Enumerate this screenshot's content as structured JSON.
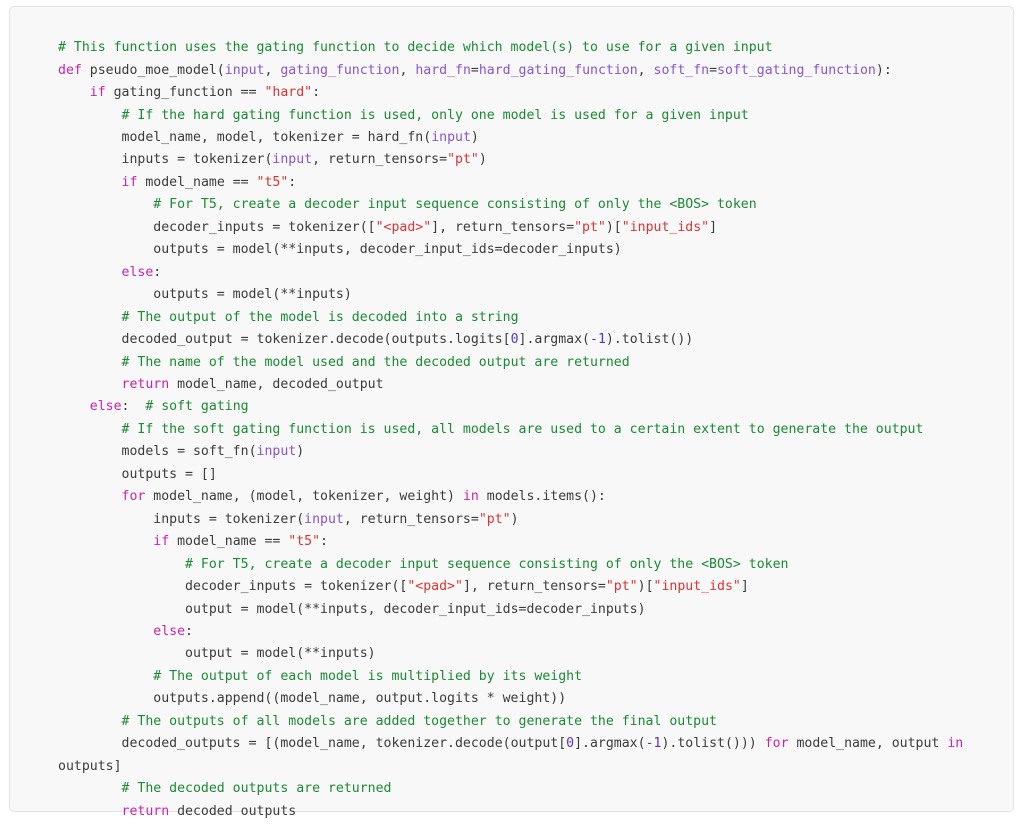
{
  "card": {
    "background_color": "#f8f8f8",
    "border_color": "#e3e3e3",
    "language": "python"
  },
  "theme": {
    "plain_color": "#3b3b3b",
    "comment_color": "#1a8a33",
    "keyword_color": "#cc22aa",
    "string_color": "#dd3333",
    "param_color": "#8855cc",
    "number_color": "#5533cc"
  },
  "code": {
    "title": "pseudo_moe_model",
    "lines": [
      {
        "id": "line-1",
        "text": "# This function uses the gating function to decide which model(s) to use for a given input"
      },
      {
        "id": "line-2",
        "text": "def pseudo_moe_model(input, gating_function, hard_fn=hard_gating_function, soft_fn=soft_gating_function):"
      },
      {
        "id": "line-3",
        "text": "    if gating_function == \"hard\":"
      },
      {
        "id": "line-4",
        "text": "        # If the hard gating function is used, only one model is used for a given input"
      },
      {
        "id": "line-5",
        "text": "        model_name, model, tokenizer = hard_fn(input)"
      },
      {
        "id": "line-6",
        "text": "        inputs = tokenizer(input, return_tensors=\"pt\")"
      },
      {
        "id": "line-7",
        "text": "        if model_name == \"t5\":"
      },
      {
        "id": "line-8",
        "text": "            # For T5, create a decoder input sequence consisting of only the <BOS> token"
      },
      {
        "id": "line-9",
        "text": "            decoder_inputs = tokenizer([\"<pad>\"], return_tensors=\"pt\")[\"input_ids\"]"
      },
      {
        "id": "line-10",
        "text": "            outputs = model(**inputs, decoder_input_ids=decoder_inputs)"
      },
      {
        "id": "line-11",
        "text": "        else:"
      },
      {
        "id": "line-12",
        "text": "            outputs = model(**inputs)"
      },
      {
        "id": "line-13",
        "text": "        # The output of the model is decoded into a string"
      },
      {
        "id": "line-14",
        "text": "        decoded_output = tokenizer.decode(outputs.logits[0].argmax(-1).tolist())"
      },
      {
        "id": "line-15",
        "text": "        # The name of the model used and the decoded output are returned"
      },
      {
        "id": "line-16",
        "text": "        return model_name, decoded_output"
      },
      {
        "id": "line-17",
        "text": "    else:  # soft gating"
      },
      {
        "id": "line-18",
        "text": "        # If the soft gating function is used, all models are used to a certain extent to generate the output"
      },
      {
        "id": "line-19",
        "text": "        models = soft_fn(input)"
      },
      {
        "id": "line-20",
        "text": "        outputs = []"
      },
      {
        "id": "line-21",
        "text": "        for model_name, (model, tokenizer, weight) in models.items():"
      },
      {
        "id": "line-22",
        "text": "            inputs = tokenizer(input, return_tensors=\"pt\")"
      },
      {
        "id": "line-23",
        "text": "            if model_name == \"t5\":"
      },
      {
        "id": "line-24",
        "text": "                # For T5, create a decoder input sequence consisting of only the <BOS> token"
      },
      {
        "id": "line-25",
        "text": "                decoder_inputs = tokenizer([\"<pad>\"], return_tensors=\"pt\")[\"input_ids\"]"
      },
      {
        "id": "line-26",
        "text": "                output = model(**inputs, decoder_input_ids=decoder_inputs)"
      },
      {
        "id": "line-27",
        "text": "            else:"
      },
      {
        "id": "line-28",
        "text": "                output = model(**inputs)"
      },
      {
        "id": "line-29",
        "text": "            # The output of each model is multiplied by its weight"
      },
      {
        "id": "line-30",
        "text": "            outputs.append((model_name, output.logits * weight))"
      },
      {
        "id": "line-31",
        "text": "        # The outputs of all models are added together to generate the final output"
      },
      {
        "id": "line-32",
        "text": "        decoded_outputs = [(model_name, tokenizer.decode(output[0].argmax(-1).tolist())) for model_name, output in outputs]"
      },
      {
        "id": "line-33",
        "text": "        # The decoded outputs are returned"
      },
      {
        "id": "line-34",
        "text": "        return decoded outputs"
      }
    ],
    "tokens": [
      [
        {
          "t": "# This function uses the gating function to decide which model(s) to use for a given input",
          "c": "cm"
        }
      ],
      [
        {
          "t": "def",
          "c": "kw"
        },
        {
          "t": " pseudo_moe_model(",
          "c": "pl"
        },
        {
          "t": "input",
          "c": "pa"
        },
        {
          "t": ", ",
          "c": "pl"
        },
        {
          "t": "gating_function",
          "c": "pa"
        },
        {
          "t": ", ",
          "c": "pl"
        },
        {
          "t": "hard_fn",
          "c": "pa"
        },
        {
          "t": "=",
          "c": "pl"
        },
        {
          "t": "hard_gating_function",
          "c": "pa"
        },
        {
          "t": ", ",
          "c": "pl"
        },
        {
          "t": "soft_fn",
          "c": "pa"
        },
        {
          "t": "=",
          "c": "pl"
        },
        {
          "t": "soft_gating_function",
          "c": "pa"
        },
        {
          "t": "):",
          "c": "pl"
        }
      ],
      [
        {
          "t": "    ",
          "c": "pl"
        },
        {
          "t": "if",
          "c": "kw"
        },
        {
          "t": " gating_function == ",
          "c": "pl"
        },
        {
          "t": "\"hard\"",
          "c": "st"
        },
        {
          "t": ":",
          "c": "pl"
        }
      ],
      [
        {
          "t": "        # If the hard gating function is used, only one model is used for a given input",
          "c": "cm"
        }
      ],
      [
        {
          "t": "        model_name, model, tokenizer = hard_fn(",
          "c": "pl"
        },
        {
          "t": "input",
          "c": "pa"
        },
        {
          "t": ")",
          "c": "pl"
        }
      ],
      [
        {
          "t": "        inputs = tokenizer(",
          "c": "pl"
        },
        {
          "t": "input",
          "c": "pa"
        },
        {
          "t": ", return_tensors=",
          "c": "pl"
        },
        {
          "t": "\"pt\"",
          "c": "st"
        },
        {
          "t": ")",
          "c": "pl"
        }
      ],
      [
        {
          "t": "        ",
          "c": "pl"
        },
        {
          "t": "if",
          "c": "kw"
        },
        {
          "t": " model_name == ",
          "c": "pl"
        },
        {
          "t": "\"t5\"",
          "c": "st"
        },
        {
          "t": ":",
          "c": "pl"
        }
      ],
      [
        {
          "t": "            # For T5, create a decoder input sequence consisting of only the <BOS> token",
          "c": "cm"
        }
      ],
      [
        {
          "t": "            decoder_inputs = tokenizer([",
          "c": "pl"
        },
        {
          "t": "\"<pad>\"",
          "c": "st"
        },
        {
          "t": "], return_tensors=",
          "c": "pl"
        },
        {
          "t": "\"pt\"",
          "c": "st"
        },
        {
          "t": ")[",
          "c": "pl"
        },
        {
          "t": "\"input_ids\"",
          "c": "st"
        },
        {
          "t": "]",
          "c": "pl"
        }
      ],
      [
        {
          "t": "            outputs = model(**inputs, decoder_input_ids=decoder_inputs)",
          "c": "pl"
        }
      ],
      [
        {
          "t": "        ",
          "c": "pl"
        },
        {
          "t": "else",
          "c": "kw"
        },
        {
          "t": ":",
          "c": "pl"
        }
      ],
      [
        {
          "t": "            outputs = model(**inputs)",
          "c": "pl"
        }
      ],
      [
        {
          "t": "        # The output of the model is decoded into a string",
          "c": "cm"
        }
      ],
      [
        {
          "t": "        decoded_output = tokenizer.decode(outputs.logits[",
          "c": "pl"
        },
        {
          "t": "0",
          "c": "nu"
        },
        {
          "t": "].argmax(",
          "c": "pl"
        },
        {
          "t": "-1",
          "c": "nu"
        },
        {
          "t": ").tolist())",
          "c": "pl"
        }
      ],
      [
        {
          "t": "        # The name of the model used and the decoded output are returned",
          "c": "cm"
        }
      ],
      [
        {
          "t": "        ",
          "c": "pl"
        },
        {
          "t": "return",
          "c": "kw"
        },
        {
          "t": " model_name, decoded_output",
          "c": "pl"
        }
      ],
      [
        {
          "t": "    ",
          "c": "pl"
        },
        {
          "t": "else",
          "c": "kw"
        },
        {
          "t": ":  ",
          "c": "pl"
        },
        {
          "t": "# soft gating",
          "c": "cm"
        }
      ],
      [
        {
          "t": "        # If the soft gating function is used, all models are used to a certain extent to generate the output",
          "c": "cm"
        }
      ],
      [
        {
          "t": "        models = soft_fn(",
          "c": "pl"
        },
        {
          "t": "input",
          "c": "pa"
        },
        {
          "t": ")",
          "c": "pl"
        }
      ],
      [
        {
          "t": "        outputs = []",
          "c": "pl"
        }
      ],
      [
        {
          "t": "        ",
          "c": "pl"
        },
        {
          "t": "for",
          "c": "kw"
        },
        {
          "t": " model_name, (model, tokenizer, weight) ",
          "c": "pl"
        },
        {
          "t": "in",
          "c": "kw"
        },
        {
          "t": " models.items():",
          "c": "pl"
        }
      ],
      [
        {
          "t": "            inputs = tokenizer(",
          "c": "pl"
        },
        {
          "t": "input",
          "c": "pa"
        },
        {
          "t": ", return_tensors=",
          "c": "pl"
        },
        {
          "t": "\"pt\"",
          "c": "st"
        },
        {
          "t": ")",
          "c": "pl"
        }
      ],
      [
        {
          "t": "            ",
          "c": "pl"
        },
        {
          "t": "if",
          "c": "kw"
        },
        {
          "t": " model_name == ",
          "c": "pl"
        },
        {
          "t": "\"t5\"",
          "c": "st"
        },
        {
          "t": ":",
          "c": "pl"
        }
      ],
      [
        {
          "t": "                # For T5, create a decoder input sequence consisting of only the <BOS> token",
          "c": "cm"
        }
      ],
      [
        {
          "t": "                decoder_inputs = tokenizer([",
          "c": "pl"
        },
        {
          "t": "\"<pad>\"",
          "c": "st"
        },
        {
          "t": "], return_tensors=",
          "c": "pl"
        },
        {
          "t": "\"pt\"",
          "c": "st"
        },
        {
          "t": ")[",
          "c": "pl"
        },
        {
          "t": "\"input_ids\"",
          "c": "st"
        },
        {
          "t": "]",
          "c": "pl"
        }
      ],
      [
        {
          "t": "                output = model(**inputs, decoder_input_ids=decoder_inputs)",
          "c": "pl"
        }
      ],
      [
        {
          "t": "            ",
          "c": "pl"
        },
        {
          "t": "else",
          "c": "kw"
        },
        {
          "t": ":",
          "c": "pl"
        }
      ],
      [
        {
          "t": "                output = model(**inputs)",
          "c": "pl"
        }
      ],
      [
        {
          "t": "            # The output of each model is multiplied by its weight",
          "c": "cm"
        }
      ],
      [
        {
          "t": "            outputs.append((model_name, output.logits * weight))",
          "c": "pl"
        }
      ],
      [
        {
          "t": "        # The outputs of all models are added together to generate the final output",
          "c": "cm"
        }
      ],
      [
        {
          "t": "        decoded_outputs = [(model_name, tokenizer.decode(output[",
          "c": "pl"
        },
        {
          "t": "0",
          "c": "nu"
        },
        {
          "t": "].argmax(",
          "c": "pl"
        },
        {
          "t": "-1",
          "c": "nu"
        },
        {
          "t": ").tolist())) ",
          "c": "pl"
        },
        {
          "t": "for",
          "c": "kw"
        },
        {
          "t": " model_name, output ",
          "c": "pl"
        },
        {
          "t": "in",
          "c": "kw"
        },
        {
          "t": " outputs]",
          "c": "pl"
        }
      ],
      [
        {
          "t": "        # The decoded outputs are returned",
          "c": "cm"
        }
      ],
      [
        {
          "t": "        ",
          "c": "pl"
        },
        {
          "t": "return",
          "c": "kw"
        },
        {
          "t": " decoded outputs",
          "c": "pl"
        }
      ]
    ]
  }
}
